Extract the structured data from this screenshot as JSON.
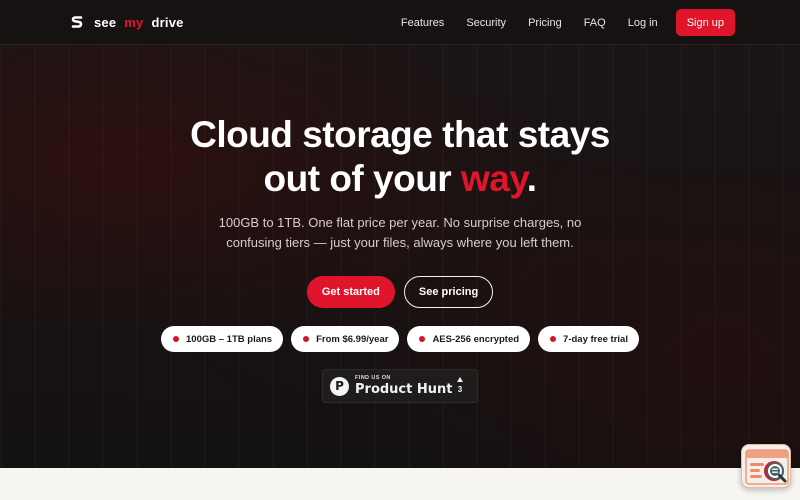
{
  "brand": {
    "parts": [
      "see",
      "my",
      "drive"
    ],
    "accent_color": "#e0142b"
  },
  "nav": {
    "links": [
      "Features",
      "Security",
      "Pricing",
      "FAQ",
      "Log in"
    ],
    "signup_label": "Sign up"
  },
  "hero": {
    "headline_line1": "Cloud storage that stays",
    "headline_line2_prefix": "out of your ",
    "headline_accent": "way",
    "headline_suffix": ".",
    "subtext_line1": "100GB to 1TB. One flat price per year. No surprise charges, no",
    "subtext_line2": "confusing tiers — just your files, always where you left them.",
    "cta_primary": "Get started",
    "cta_secondary": "See pricing"
  },
  "badges": [
    "100GB – 1TB plans",
    "From $6.99/year",
    "AES-256 encrypted",
    "7-day free trial"
  ],
  "product_hunt": {
    "small_label": "FIND US ON",
    "name": "Product Hunt",
    "logo_letter": "P",
    "upvotes": "3"
  },
  "icons": {
    "logo": "brand-s-icon",
    "product_hunt": "product-hunt-icon",
    "upvote": "triangle-up-icon",
    "chat_widget": "chat-search-icon"
  }
}
